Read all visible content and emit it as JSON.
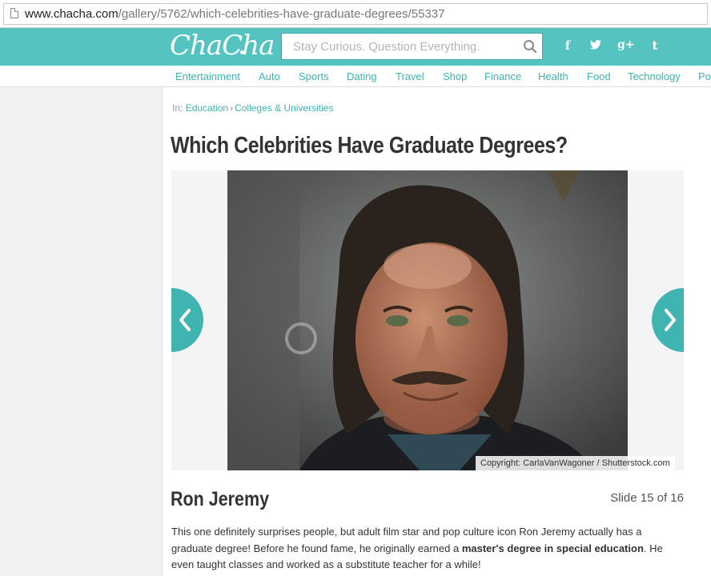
{
  "browser": {
    "url_domain": "www.chacha.com",
    "url_path": "/gallery/5762/which-celebrities-have-graduate-degrees/55337"
  },
  "header": {
    "logo": "ChaCha",
    "search_placeholder": "Stay Curious. Question Everything.",
    "social": [
      "f",
      "t",
      "g+",
      "t"
    ],
    "brand_color": "#55c4c0"
  },
  "nav": {
    "categories": [
      "Entertainment",
      "Auto",
      "Sports",
      "Dating",
      "Travel",
      "Shop",
      "Finance",
      "Health",
      "Food",
      "Technology",
      "Pol"
    ]
  },
  "breadcrumb": {
    "prefix": "In:",
    "items": [
      "Education",
      "Colleges & Universities"
    ],
    "separator": "›"
  },
  "article": {
    "title": "Which Celebrities Have Graduate Degrees?"
  },
  "slide": {
    "image_credit": "Copyright: CarlaVanWagoner / Shutterstock.com",
    "name": "Ron Jeremy",
    "counter": "Slide 15 of 16",
    "text_before": "This one definitely surprises people, but adult film star and pop culture icon Ron Jeremy actually has a graduate degree! Before he found fame, he originally earned a ",
    "text_bold": "master's degree in special education",
    "text_after": ". He even taught classes and worked as a substitute teacher for a while!"
  },
  "icons": {
    "prev": "chevron-left-icon",
    "next": "chevron-right-icon",
    "search": "search-icon",
    "page": "page-icon"
  }
}
